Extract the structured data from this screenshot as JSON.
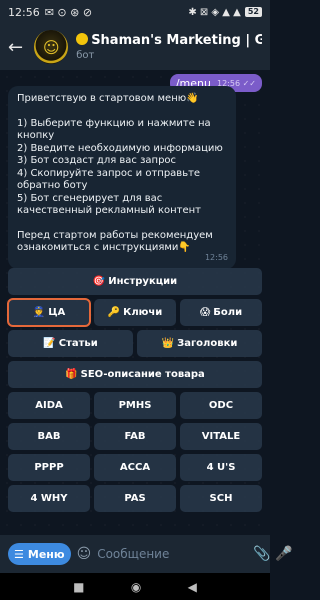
{
  "status": {
    "time": "12:56",
    "left_icons": "✉ ⊙ ⊛ ⊘",
    "right_icons": "✱ ⊠ ◈ ▲ ▲",
    "battery": "52"
  },
  "header": {
    "title": "Shaman's Marketing | GP",
    "subtitle": "бот"
  },
  "messages": {
    "outgoing": {
      "text": "/menu",
      "time": "12:56",
      "status": "✓✓"
    },
    "incoming": {
      "greeting": "Приветствую в стартовом меню👋",
      "steps": [
        "1) Выберите функцию и нажмите на кнопку",
        "2) Введите необходимую информацию",
        "3) Бот создаст для вас запрос",
        "4) Скопируйте запрос и отправьте обратно боту",
        "5) Бот сгенерирует для вас качественный рекламный контент"
      ],
      "footer": "Перед стартом работы рекомендуем ознакомиться с инструкциями👇",
      "time": "12:56"
    }
  },
  "keyboard": {
    "instructions": {
      "icon": "🎯",
      "label": "Инструкции"
    },
    "ca": {
      "icon": "👮",
      "label": "ЦА"
    },
    "keys": {
      "icon": "🔑",
      "label": "Ключи"
    },
    "pains": {
      "icon": "😱",
      "label": "Боли"
    },
    "articles": {
      "icon": "📝",
      "label": "Статьи"
    },
    "headlines": {
      "icon": "👑",
      "label": "Заголовки"
    },
    "seo": {
      "icon": "🎁",
      "label": "SEO-описание товара"
    },
    "row1": [
      "AIDA",
      "PMHS",
      "ODC"
    ],
    "row2": [
      "BAB",
      "FAB",
      "VITALE"
    ],
    "row3": [
      "PPPP",
      "ACCA",
      "4 U'S"
    ],
    "row4": [
      "4 WHY",
      "PAS",
      "SCH"
    ]
  },
  "input": {
    "menu_label": "Меню",
    "placeholder": "Сообщение",
    "emoji_icon": "☺",
    "attach_icon": "📎",
    "mic_icon": "🎤"
  },
  "nav": {
    "square": "■",
    "circle": "◉",
    "back": "◀"
  },
  "colors": {
    "accent": "#3d8ae0",
    "outgoing_bubble": "#7b5cc9",
    "highlight": "#e5683a"
  }
}
